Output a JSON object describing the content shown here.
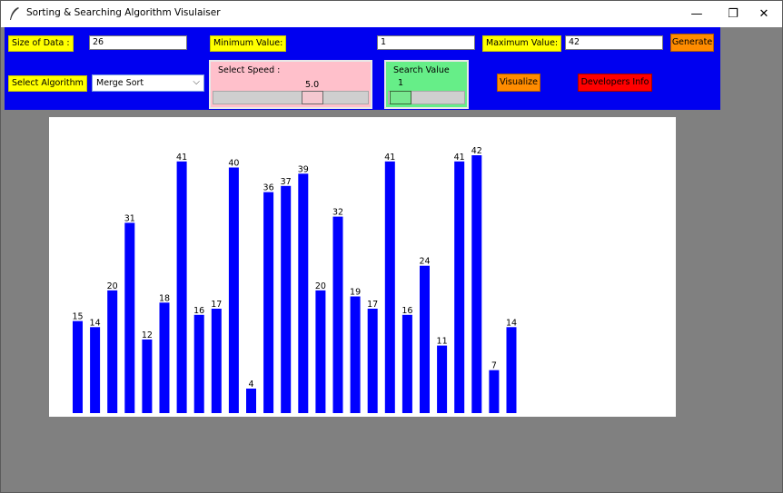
{
  "window": {
    "title": "Sorting & Searching Algorithm Visulaiser",
    "minimize": "—",
    "restore": "❐",
    "close": "✕"
  },
  "controls": {
    "size_label": "Size of Data :",
    "size_value": "26",
    "min_label": "Minimum Value:",
    "min_value": "1",
    "max_label": "Maximum Value:",
    "max_value": "42",
    "generate_label": "Generate",
    "algorithm_label": "Select Algorithm",
    "algorithm_selected": "Merge Sort",
    "speed_label": "Select Speed :",
    "speed_value": "5.0",
    "speed_fraction": 0.5,
    "search_label": "Search Value",
    "search_value": "1",
    "search_fraction": 0.0,
    "visualize_label": "Visualize",
    "developers_label": "Developers Info"
  },
  "colors": {
    "panel": "#0000f0",
    "bar": "#0000ff",
    "label_bg": "#ffff00",
    "button_orange": "#ff8c00",
    "button_red": "#ff0000",
    "speed_panel": "#ffc0cb",
    "search_panel": "#66ee88"
  },
  "icons": {
    "app": "feather-icon",
    "select_caret": "chevron-down-icon"
  },
  "chart_data": {
    "type": "bar",
    "values": [
      15,
      14,
      20,
      31,
      12,
      18,
      41,
      16,
      17,
      40,
      4,
      36,
      37,
      39,
      20,
      32,
      19,
      17,
      41,
      16,
      24,
      11,
      41,
      42,
      7,
      14
    ],
    "ylim": [
      0,
      42
    ]
  }
}
